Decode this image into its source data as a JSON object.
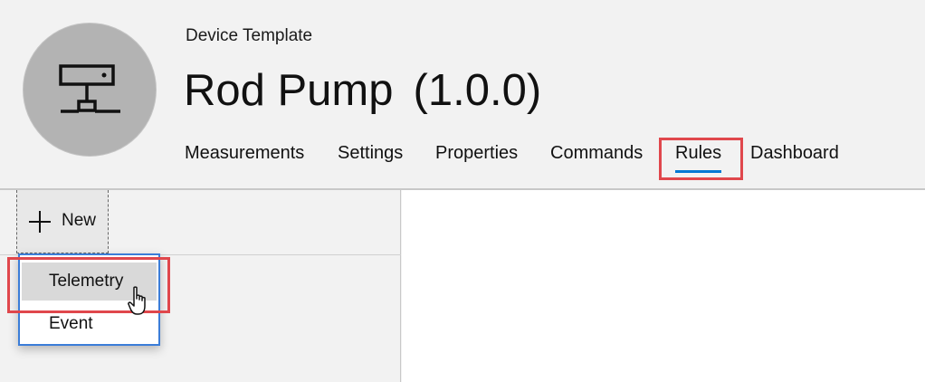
{
  "header": {
    "subtitle": "Device Template",
    "title": "Rod Pump",
    "version": "(1.0.0)",
    "avatar_icon": "device-network-icon"
  },
  "tabs": [
    {
      "label": "Measurements"
    },
    {
      "label": "Settings"
    },
    {
      "label": "Properties"
    },
    {
      "label": "Commands"
    },
    {
      "label": "Rules",
      "active": true
    },
    {
      "label": "Dashboard"
    }
  ],
  "toolbar": {
    "new_label": "New",
    "new_icon": "plus-icon"
  },
  "dropdown": {
    "items": [
      {
        "label": "Telemetry",
        "hovered": true
      },
      {
        "label": "Event"
      }
    ]
  },
  "colors": {
    "accent": "#0078d4",
    "highlight": "#e0474c",
    "menu_border": "#3b7dd8"
  }
}
